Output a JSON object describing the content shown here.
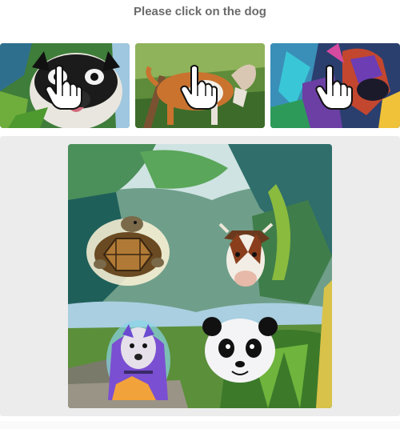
{
  "prompt": {
    "text": "Please click on the dog"
  },
  "thumbnails": [
    {
      "subject": "pug-dog",
      "overlay_icon": "pointing-hand-cursor-icon"
    },
    {
      "subject": "brown-dog",
      "overlay_icon": "pointing-hand-cursor-icon"
    },
    {
      "subject": "colorful-dog",
      "overlay_icon": "pointing-hand-cursor-icon"
    }
  ],
  "main_image": {
    "animals": [
      "turtle",
      "cow",
      "dog",
      "panda"
    ]
  },
  "colors": {
    "prompt_text": "#6b6b6b",
    "panel_background": "#ececec",
    "page_background": "#ffffff"
  }
}
